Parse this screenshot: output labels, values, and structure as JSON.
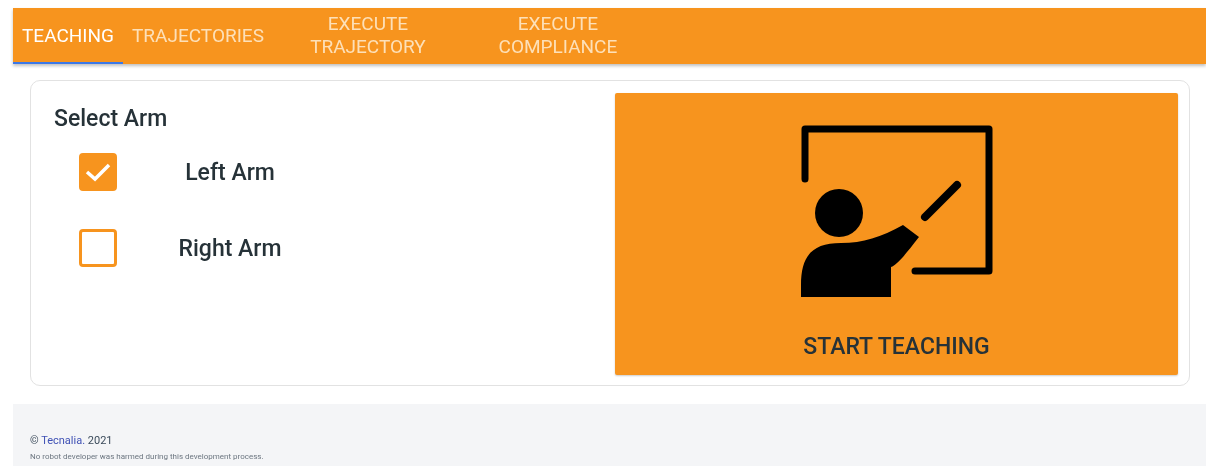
{
  "tabs": [
    {
      "label": "TEACHING",
      "selected": true
    },
    {
      "label": "TRAJECTORIES",
      "selected": false
    },
    {
      "label": "EXECUTE TRAJECTORY",
      "selected": false
    },
    {
      "label": "EXECUTE COMPLIANCE",
      "selected": false
    }
  ],
  "arm_selection": {
    "title": "Select Arm",
    "options": [
      {
        "label": "Left Arm",
        "checked": true
      },
      {
        "label": "Right Arm",
        "checked": false
      }
    ]
  },
  "start_button": {
    "label": "START TEACHING"
  },
  "footer": {
    "copyright": "©",
    "link": "Tecnalia.",
    "year": "2021",
    "note": "No robot developer was harmed during this development process."
  }
}
